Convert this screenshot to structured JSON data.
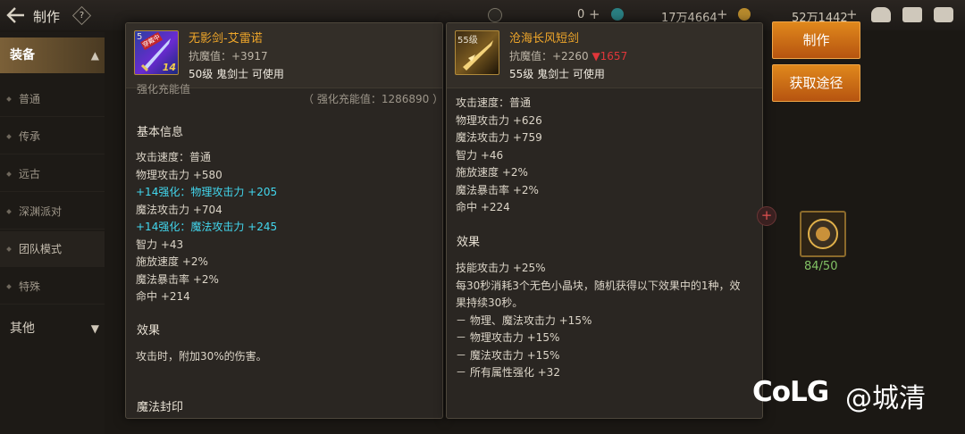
{
  "header": {
    "title": "制作",
    "help": "?",
    "currency1": "0",
    "currency2": "17万4664",
    "currency3": "52万1442",
    "plus": "+"
  },
  "sidebar": {
    "category_equip": "装备",
    "items": [
      "普通",
      "传承",
      "远古",
      "深渊派对",
      "团队模式",
      "特殊"
    ],
    "category_other": "其他"
  },
  "card_left": {
    "level_badge": "5",
    "tag": "穿戴中",
    "enhance": "14",
    "name": "无影剑-艾雷诺",
    "resist": "抗魔值：+3917",
    "level_line": "50级 鬼剑士 可使用",
    "section_partial": "强化充能值",
    "recharge": "（ 强化充能值：1286890 ）",
    "basic_title": "基本信息",
    "lines": [
      "攻击速度：普通",
      "物理攻击力 +580",
      "+14强化：物理攻击力 +205",
      "魔法攻击力 +704",
      "+14强化：魔法攻击力 +245",
      "智力 +43",
      "施放速度 +2%",
      "魔法暴击率 +2%",
      "命中 +214"
    ],
    "effect_title": "效果",
    "effect_text": "攻击时，附加30%的伤害。",
    "seal_title": "魔法封印"
  },
  "card_right": {
    "level_badge": "55级",
    "name": "沧海长风短剑",
    "resist": "抗魔值：+2260",
    "resist_diff": "▼1657",
    "level_line": "55级 鬼剑士 可使用",
    "lines": [
      "攻击速度：普通",
      "物理攻击力 +626",
      "魔法攻击力 +759",
      "智力 +46",
      "施放速度 +2%",
      "魔法暴击率 +2%",
      "命中 +224"
    ],
    "effect_title": "效果",
    "effect_lines": [
      "技能攻击力 +25%",
      "每30秒消耗3个无色小晶块，随机获得以下效果中的1种，效",
      "果持续30秒。",
      "－ 物理、魔法攻击力 +15%",
      "－ 物理攻击力 +15%",
      "－ 魔法攻击力 +15%",
      "－ 所有属性强化 +32"
    ]
  },
  "actions": {
    "make": "制作",
    "source": "获取途径"
  },
  "material": {
    "count": "84/50",
    "plus": "+"
  },
  "watermark": {
    "brand": "CoLG",
    "user": "@城清"
  },
  "colors": {
    "accent_orange": "#f0a72a",
    "cyan": "#42d7ee",
    "down_red": "#e0363a",
    "green": "#82c265"
  }
}
